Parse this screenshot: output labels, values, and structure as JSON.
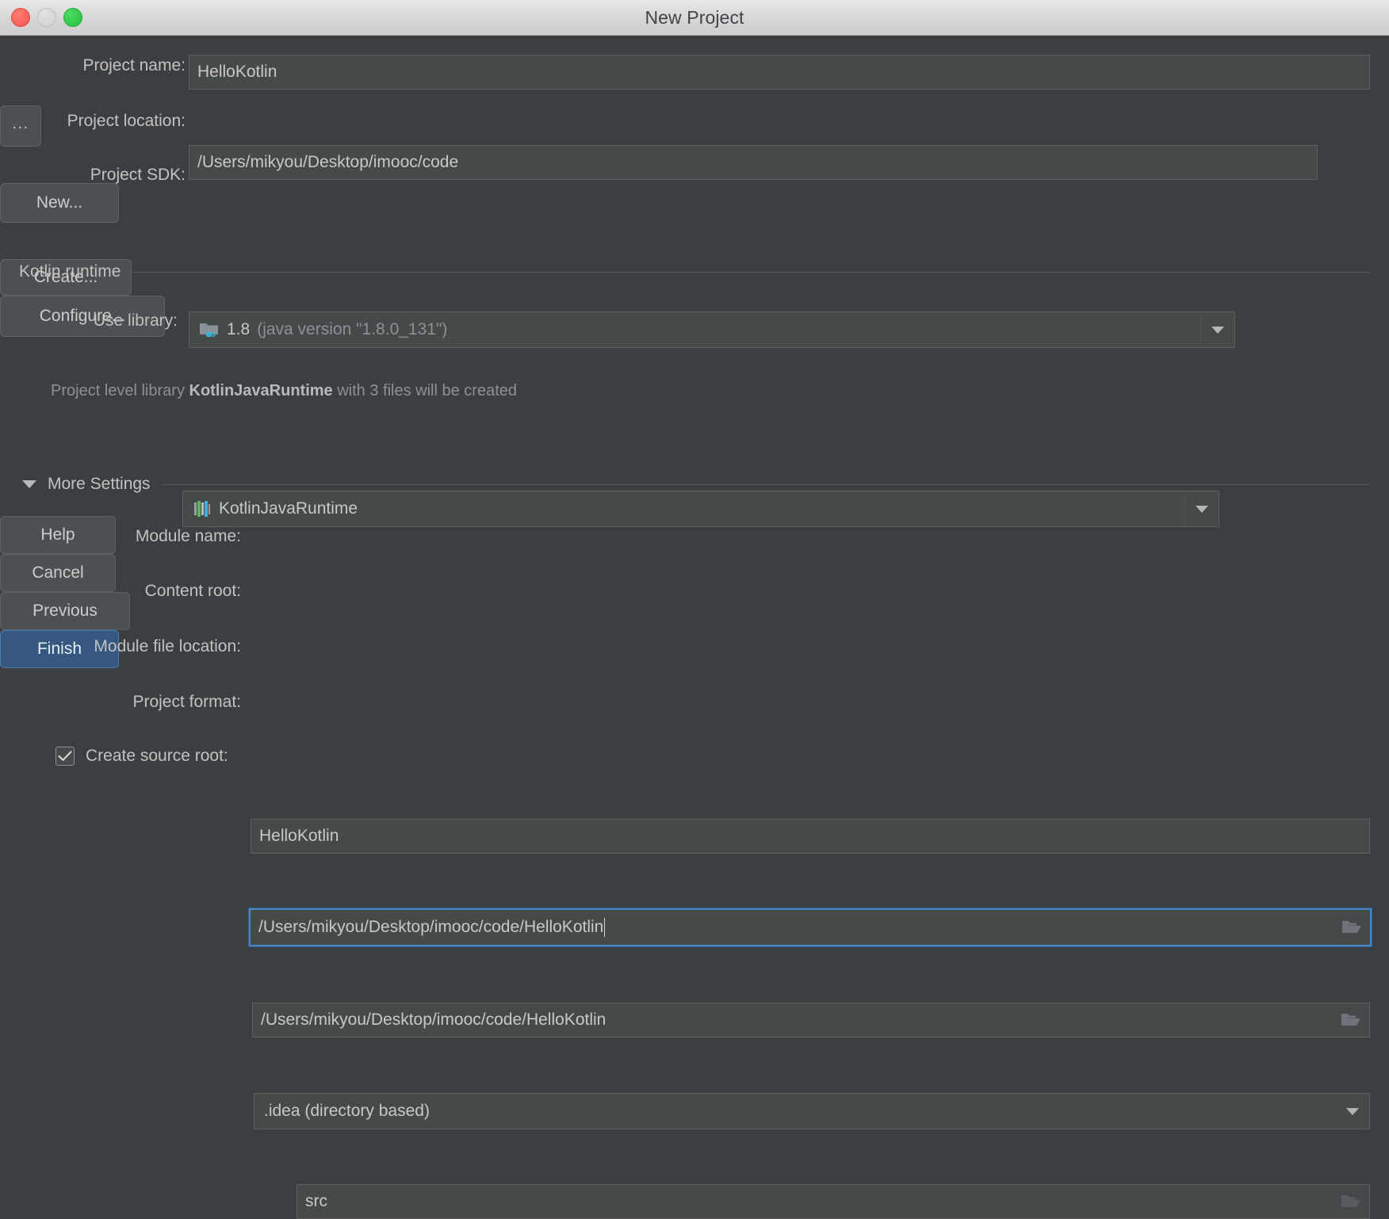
{
  "window": {
    "title": "New Project",
    "controls": {
      "close": "close-button",
      "minimize": "minimize-button",
      "maximize": "maximize-button"
    }
  },
  "form": {
    "project_name": {
      "label": "Project name:",
      "value": "HelloKotlin"
    },
    "project_location": {
      "label": "Project location:",
      "value": "/Users/mikyou/Desktop/imooc/code",
      "browse_label": "..."
    },
    "project_sdk": {
      "label": "Project SDK:",
      "value": "1.8",
      "detail": "(java version \"1.8.0_131\")",
      "new_button": "New..."
    }
  },
  "kotlin_runtime": {
    "section_label": "Kotlin runtime",
    "use_library": {
      "label": "Use library:",
      "value": "KotlinJavaRuntime",
      "create_button": "Create..."
    },
    "hint_prefix": "Project level library ",
    "hint_bold": "KotlinJavaRuntime",
    "hint_suffix": " with 3 files will be created",
    "configure_button": "Configure..."
  },
  "more_settings": {
    "section_label": "More Settings",
    "module_name": {
      "label": "Module name:",
      "value": "HelloKotlin"
    },
    "content_root": {
      "label": "Content root:",
      "value": "/Users/mikyou/Desktop/imooc/code/HelloKotlin"
    },
    "module_file_location": {
      "label": "Module file location:",
      "value": "/Users/mikyou/Desktop/imooc/code/HelloKotlin"
    },
    "project_format": {
      "label": "Project format:",
      "value": ".idea (directory based)"
    },
    "create_source_root": {
      "label": "Create source root:",
      "value": "src",
      "checked": true
    }
  },
  "footer": {
    "help": "Help",
    "cancel": "Cancel",
    "previous": "Previous",
    "finish": "Finish"
  },
  "colors": {
    "background": "#3c3f41",
    "field_background": "#45494a",
    "focus_border": "#4a88c7",
    "default_button": "#365880",
    "text": "#c2c2c2",
    "muted_text": "#8d9094",
    "titlebar": "#d6d6d6"
  }
}
